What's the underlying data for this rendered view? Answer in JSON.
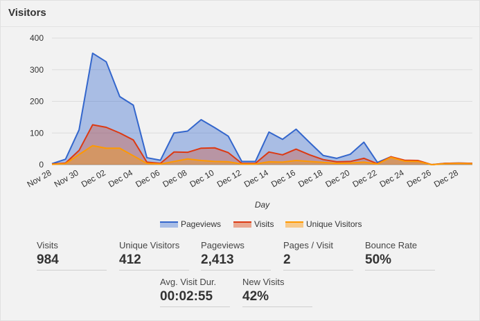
{
  "panel": {
    "title": "Visitors"
  },
  "colors": {
    "pageviews": "#3366cc",
    "visits": "#dc3912",
    "unique": "#ff9900"
  },
  "legend": [
    {
      "key": "pageviews",
      "label": "Pageviews"
    },
    {
      "key": "visits",
      "label": "Visits"
    },
    {
      "key": "unique",
      "label": "Unique Visitors"
    }
  ],
  "stats": {
    "visits": {
      "label": "Visits",
      "value": "984"
    },
    "unique_visitors": {
      "label": "Unique Visitors",
      "value": "412"
    },
    "pageviews": {
      "label": "Pageviews",
      "value": "2,413"
    },
    "pages_per_visit": {
      "label": "Pages / Visit",
      "value": "2"
    },
    "bounce_rate": {
      "label": "Bounce Rate",
      "value": "50%"
    },
    "avg_visit_duration": {
      "label": "Avg. Visit Dur.",
      "value": "00:02:55"
    },
    "new_visits": {
      "label": "New Visits",
      "value": "42%"
    }
  },
  "chart_data": {
    "type": "area",
    "xlabel": "Day",
    "ylabel": "",
    "ylim": [
      0,
      400
    ],
    "y_ticks": [
      0,
      100,
      200,
      300,
      400
    ],
    "grid": true,
    "legend_position": "bottom",
    "tick_labels": [
      "Nov 28",
      "Nov 30",
      "Dec 02",
      "Dec 04",
      "Dec 06",
      "Dec 08",
      "Dec 10",
      "Dec 12",
      "Dec 14",
      "Dec 16",
      "Dec 18",
      "Dec 20",
      "Dec 22",
      "Dec 24",
      "Dec 26",
      "Dec 28"
    ],
    "x": [
      "Nov 28",
      "Nov 29",
      "Nov 30",
      "Dec 01",
      "Dec 02",
      "Dec 03",
      "Dec 04",
      "Dec 05",
      "Dec 06",
      "Dec 07",
      "Dec 08",
      "Dec 09",
      "Dec 10",
      "Dec 11",
      "Dec 12",
      "Dec 13",
      "Dec 14",
      "Dec 15",
      "Dec 16",
      "Dec 17",
      "Dec 18",
      "Dec 19",
      "Dec 20",
      "Dec 21",
      "Dec 22",
      "Dec 23",
      "Dec 24",
      "Dec 25",
      "Dec 26",
      "Dec 27",
      "Dec 28",
      "Dec 29"
    ],
    "series": [
      {
        "name": "Pageviews",
        "key": "pageviews",
        "values": [
          3,
          17,
          110,
          352,
          325,
          215,
          188,
          22,
          14,
          100,
          106,
          142,
          117,
          90,
          10,
          10,
          103,
          80,
          112,
          70,
          29,
          20,
          33,
          71,
          7,
          25,
          11,
          10,
          0,
          4,
          5,
          4
        ]
      },
      {
        "name": "Visits",
        "key": "visits",
        "values": [
          2,
          5,
          45,
          126,
          118,
          100,
          78,
          8,
          4,
          40,
          39,
          52,
          53,
          38,
          4,
          4,
          40,
          31,
          49,
          31,
          16,
          9,
          10,
          20,
          3,
          25,
          14,
          13,
          0,
          4,
          5,
          4
        ]
      },
      {
        "name": "Unique Visitors",
        "key": "unique",
        "values": [
          1,
          3,
          32,
          60,
          52,
          52,
          28,
          4,
          2,
          10,
          18,
          13,
          10,
          9,
          2,
          2,
          9,
          8,
          13,
          10,
          7,
          4,
          5,
          8,
          2,
          23,
          11,
          10,
          0,
          3,
          4,
          3
        ]
      }
    ]
  }
}
